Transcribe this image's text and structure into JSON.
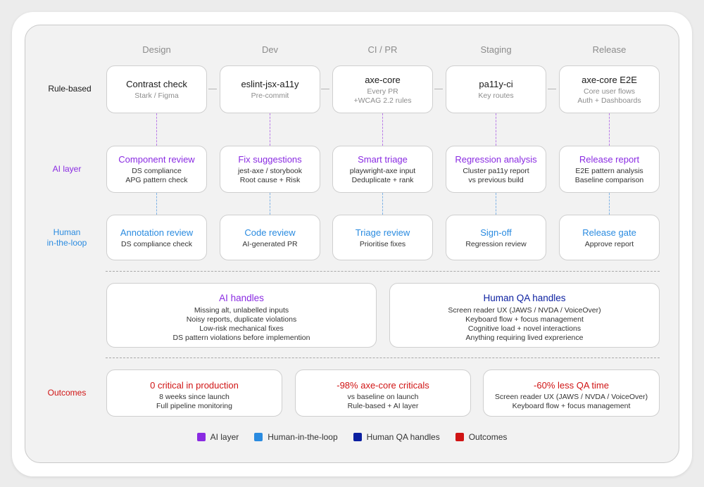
{
  "stages": [
    "Design",
    "Dev",
    "CI / PR",
    "Staging",
    "Release"
  ],
  "row_labels": {
    "rule": "Rule-based",
    "ai": "AI layer",
    "human": "Human\nin-the-loop",
    "outcomes": "Outcomes"
  },
  "rule_boxes": [
    {
      "title": "Contrast check",
      "lines": [
        "Stark / Figma"
      ]
    },
    {
      "title": "eslint-jsx-a11y",
      "lines": [
        "Pre-commit"
      ]
    },
    {
      "title": "axe-core",
      "lines": [
        "Every PR",
        "+WCAG 2.2 rules"
      ]
    },
    {
      "title": "pa11y-ci",
      "lines": [
        "Key routes"
      ]
    },
    {
      "title": "axe-core E2E",
      "lines": [
        "Core user flows",
        "Auth + Dashboards"
      ]
    }
  ],
  "ai_boxes": [
    {
      "title": "Component review",
      "lines": [
        "DS compliance",
        "APG pattern check"
      ]
    },
    {
      "title": "Fix suggestions",
      "lines": [
        "jest-axe / storybook",
        "Root cause + Risk"
      ]
    },
    {
      "title": "Smart triage",
      "lines": [
        "playwright-axe input",
        "Deduplicate + rank"
      ]
    },
    {
      "title": "Regression analysis",
      "lines": [
        "Cluster pa11y report",
        "vs previous build"
      ]
    },
    {
      "title": "Release report",
      "lines": [
        "E2E pattern analysis",
        "Baseline comparison"
      ]
    }
  ],
  "human_boxes": [
    {
      "title": "Annotation review",
      "lines": [
        "DS compliance check"
      ]
    },
    {
      "title": "Code review",
      "lines": [
        "AI-generated PR"
      ]
    },
    {
      "title": "Triage review",
      "lines": [
        "Prioritise fixes"
      ]
    },
    {
      "title": "Sign-off",
      "lines": [
        "Regression review"
      ]
    },
    {
      "title": "Release gate",
      "lines": [
        "Approve report"
      ]
    }
  ],
  "handles": [
    {
      "title": "AI handles",
      "lines": [
        "Missing alt, unlabelled inputs",
        "Noisy reports, duplicate violations",
        "Low-risk mechanical fixes",
        "DS pattern violations before implemention"
      ]
    },
    {
      "title": "Human QA handles",
      "lines": [
        "Screen reader UX (JAWS / NVDA / VoiceOver)",
        "Keyboard flow + focus management",
        "Cognitive load + novel interactions",
        "Anything requiring lived exprerience"
      ]
    }
  ],
  "outcomes": [
    {
      "title": "0 critical in production",
      "lines": [
        "8 weeks since launch",
        "Full pipeline monitoring"
      ]
    },
    {
      "title": "-98% axe-core criticals",
      "lines": [
        "vs baseline on launch",
        "Rule-based + AI layer"
      ]
    },
    {
      "title": "-60% less QA time",
      "lines": [
        "Screen reader UX (JAWS / NVDA / VoiceOver)",
        "Keyboard flow + focus management"
      ]
    }
  ],
  "legend": [
    {
      "label": "AI layer",
      "color": "#8a2be2"
    },
    {
      "label": "Human-in-the-loop",
      "color": "#2a8be0"
    },
    {
      "label": "Human QA handles",
      "color": "#0b1fa0"
    },
    {
      "label": "Outcomes",
      "color": "#d01414"
    }
  ],
  "colors": {
    "ai": "#8a2be2",
    "human": "#2a8be0",
    "human_qa": "#0b1fa0",
    "outcomes": "#d01414"
  }
}
